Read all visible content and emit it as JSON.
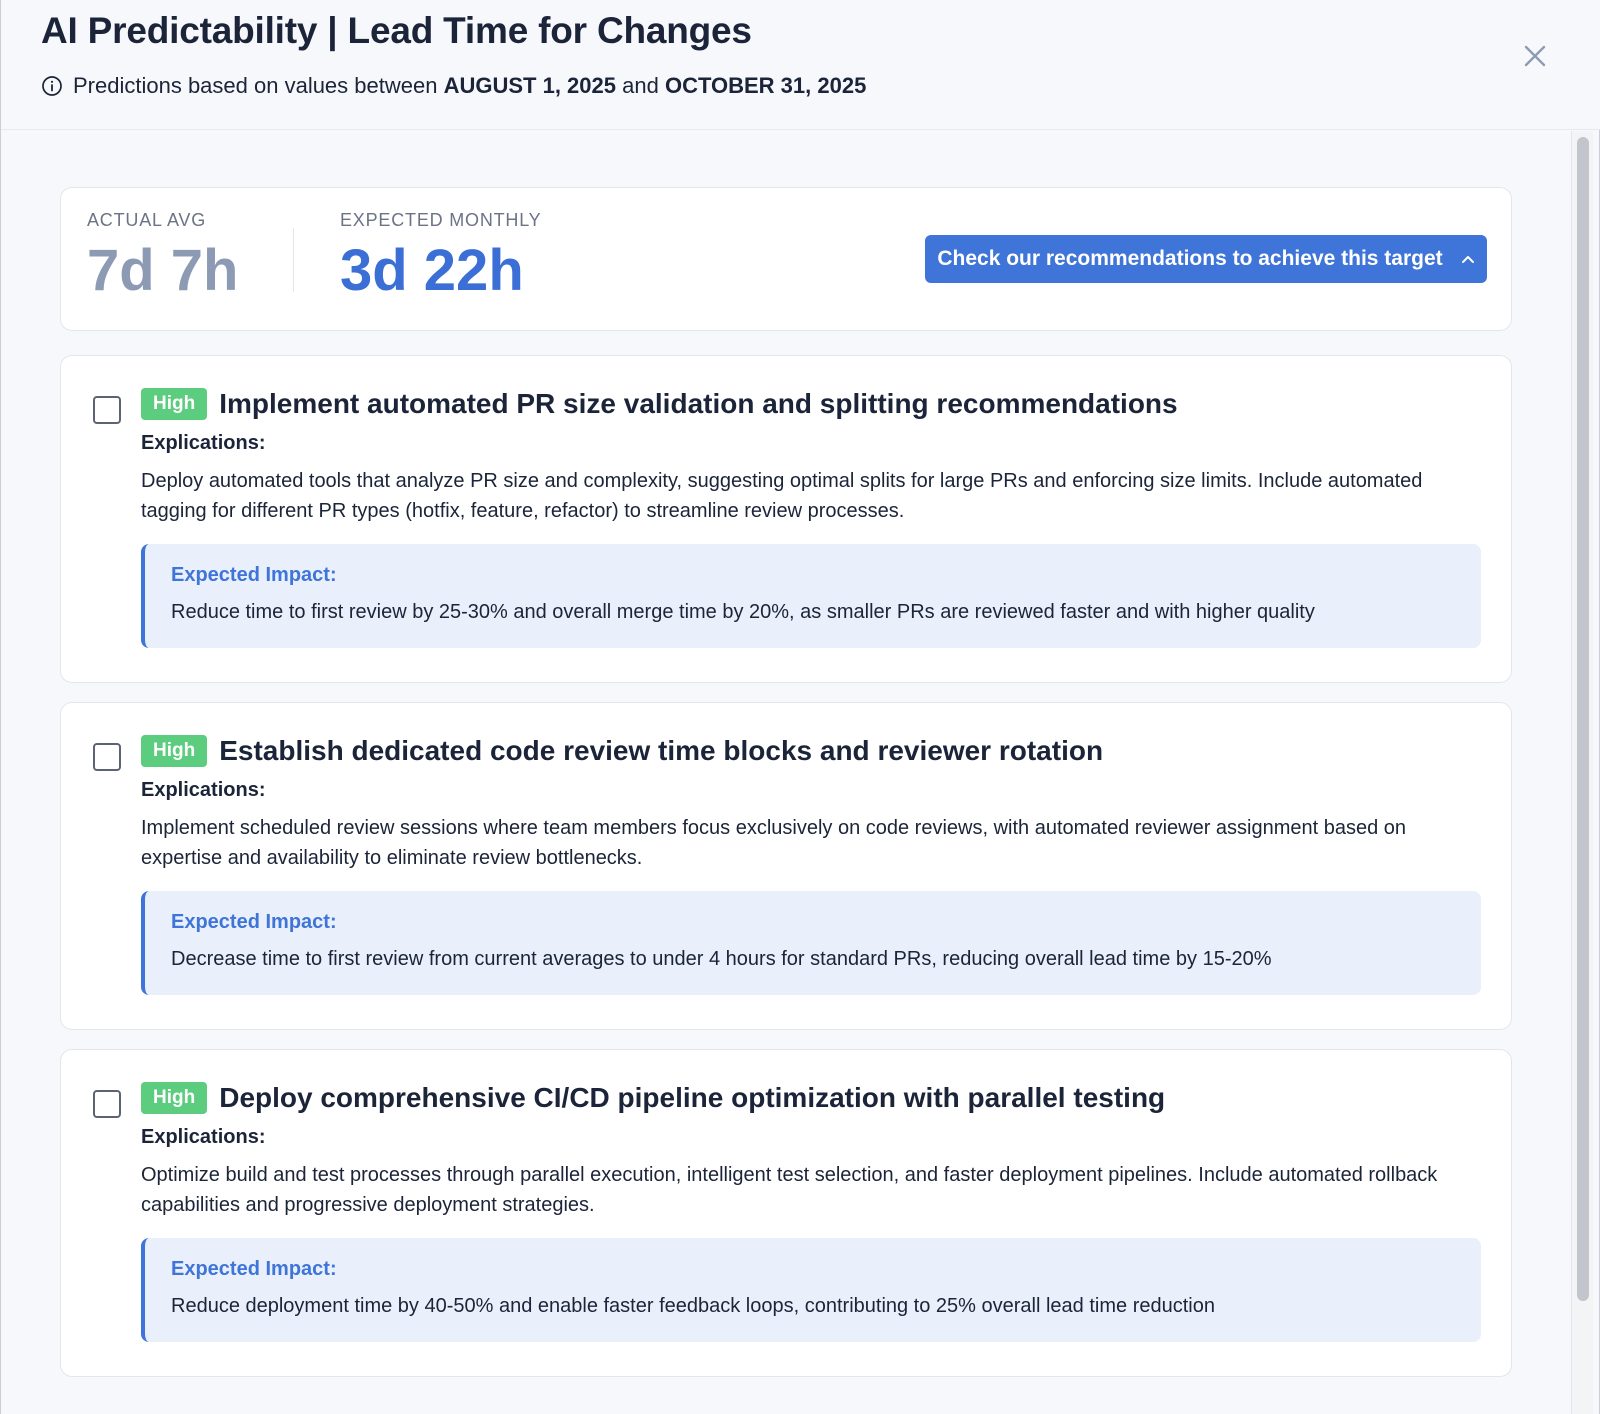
{
  "header": {
    "title": "AI Predictability | Lead Time for Changes",
    "subtitle_prefix": "Predictions based on values between",
    "start_date": "AUGUST 1, 2025",
    "conjunction": "and",
    "end_date": "OCTOBER 31, 2025"
  },
  "stats": {
    "actual_label": "ACTUAL AVG",
    "actual_value": "7d 7h",
    "expected_label": "EXPECTED MONTHLY",
    "expected_value": "3d 22h",
    "cta_label": "Check our recommendations to achieve this target"
  },
  "recommendations": [
    {
      "priority": "High",
      "title": "Implement automated PR size validation and splitting recommendations",
      "explications_label": "Explications:",
      "explication": "Deploy automated tools that analyze PR size and complexity, suggesting optimal splits for large PRs and enforcing size limits. Include automated tagging for different PR types (hotfix, feature, refactor) to streamline review processes.",
      "impact_label": "Expected Impact:",
      "impact": "Reduce time to first review by 25-30% and overall merge time by 20%, as smaller PRs are reviewed faster and with higher quality"
    },
    {
      "priority": "High",
      "title": "Establish dedicated code review time blocks and reviewer rotation",
      "explications_label": "Explications:",
      "explication": "Implement scheduled review sessions where team members focus exclusively on code reviews, with automated reviewer assignment based on expertise and availability to eliminate review bottlenecks.",
      "impact_label": "Expected Impact:",
      "impact": "Decrease time to first review from current averages to under 4 hours for standard PRs, reducing overall lead time by 15-20%"
    },
    {
      "priority": "High",
      "title": "Deploy comprehensive CI/CD pipeline optimization with parallel testing",
      "explications_label": "Explications:",
      "explication": "Optimize build and test processes through parallel execution, intelligent test selection, and faster deployment pipelines. Include automated rollback capabilities and progressive deployment strategies.",
      "impact_label": "Expected Impact:",
      "impact": "Reduce deployment time by 40-50% and enable faster feedback loops, contributing to 25% overall lead time reduction"
    }
  ],
  "colors": {
    "accent": "#3f74d8",
    "badge_high": "#5ccc7e",
    "actual_value": "#8d9ab3"
  },
  "icons": {
    "info": "info-circle-icon",
    "close": "close-icon",
    "chevron": "chevron-up-icon"
  }
}
